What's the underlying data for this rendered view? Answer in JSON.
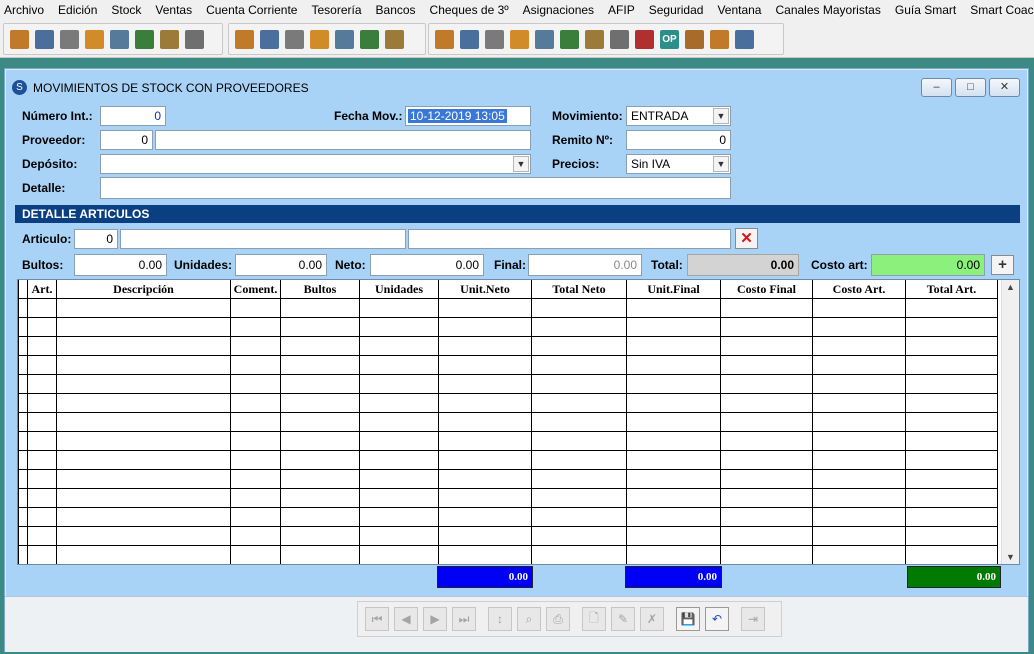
{
  "menu": [
    "Archivo",
    "Edición",
    "Stock",
    "Ventas",
    "Cuenta Corriente",
    "Tesorería",
    "Bancos",
    "Cheques de 3º",
    "Asignaciones",
    "AFIP",
    "Seguridad",
    "Ventana",
    "Canales Mayoristas",
    "Guía Smart",
    "Smart Coach"
  ],
  "toolbar": {
    "op_label": "OP",
    "group1": [
      "people-cart-icon",
      "document-list-icon",
      "clipboard-icon",
      "invoice-icon",
      "report-chart-icon",
      "refresh-doc-icon",
      "bag-doc-icon",
      "money-doc-icon"
    ],
    "group2": [
      "register-icon",
      "cash-register-icon",
      "box-register-icon",
      "red-register-icon",
      "green-box-icon",
      "orange-box-icon",
      "red-box-icon"
    ],
    "group3": [
      "user-icon",
      "money-cycle-icon",
      "search-doc-icon",
      "magnifier-icon",
      "exchange-icon",
      "bank-icon",
      "money-stack-icon",
      "card-icon",
      "money-box-icon",
      "op-icon",
      "receipt-icon",
      "bell-icon",
      "power-icon"
    ]
  },
  "window": {
    "title": "MOVIMIENTOS DE  STOCK CON PROVEEDORES",
    "min": "–",
    "max": "□",
    "close": "✕"
  },
  "form": {
    "numero_int_label": "Número Int.:",
    "numero_int_value": "0",
    "fecha_label": "Fecha Mov.:",
    "fecha_value": "10-12-2019 13:05",
    "movimiento_label": "Movimiento:",
    "movimiento_value": "ENTRADA",
    "proveedor_label": "Proveedor:",
    "proveedor_code": "0",
    "proveedor_name": "",
    "remito_label": "Remito Nº:",
    "remito_value": "0",
    "deposito_label": "Depósito:",
    "deposito_value": "",
    "precios_label": "Precios:",
    "precios_value": "Sin IVA",
    "detalle_label": "Detalle:",
    "detalle_value": ""
  },
  "section_title": "DETALLE ARTICULOS",
  "articulo": {
    "label": "Articulo:",
    "code": "0",
    "name": "",
    "extra": "",
    "bultos_label": "Bultos:",
    "bultos": "0.00",
    "unidades_label": "Unidades:",
    "unidades": "0.00",
    "neto_label": "Neto:",
    "neto": "0.00",
    "final_label": "Final:",
    "final": "0.00",
    "total_label": "Total:",
    "total": "0.00",
    "costo_label": "Costo art:",
    "costo": "0.00",
    "delete_glyph": "✕",
    "add_glyph": "+"
  },
  "grid": {
    "columns": [
      "",
      "Art.",
      "Descripción",
      "Coment.",
      "Bultos",
      "Unidades",
      "Unit.Neto",
      "Total Neto",
      "Unit.Final",
      "Costo Final",
      "Costo Art.",
      "Total Art."
    ],
    "row_count": 14
  },
  "totals": {
    "total_neto": "0.00",
    "total_final": "0.00",
    "total_art": "0.00"
  },
  "nav": {
    "first": "⏮",
    "prev": "◀",
    "next": "▶",
    "last": "⏭",
    "sort": "↕",
    "find": "⌕",
    "print": "⎙",
    "new": "🗋",
    "edit": "✎",
    "delete": "✗",
    "save": "💾",
    "undo": "↶",
    "exit": "⇥"
  }
}
